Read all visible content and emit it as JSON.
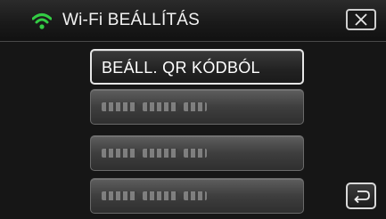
{
  "header": {
    "title": "Wi-Fi BEÁLLÍTÁS",
    "wifi_icon": "wifi-signal-icon",
    "close_icon": "close-x-icon",
    "wifi_color": "#33cc44"
  },
  "menu": {
    "items": [
      {
        "label": "BEÁLL. QR KÓDBÓL",
        "selected": true
      },
      {
        "label": "",
        "masked": true
      },
      {
        "label": "",
        "masked": true
      },
      {
        "label": "",
        "masked": true
      }
    ]
  },
  "footer": {
    "back_icon": "return-arrow-icon"
  }
}
